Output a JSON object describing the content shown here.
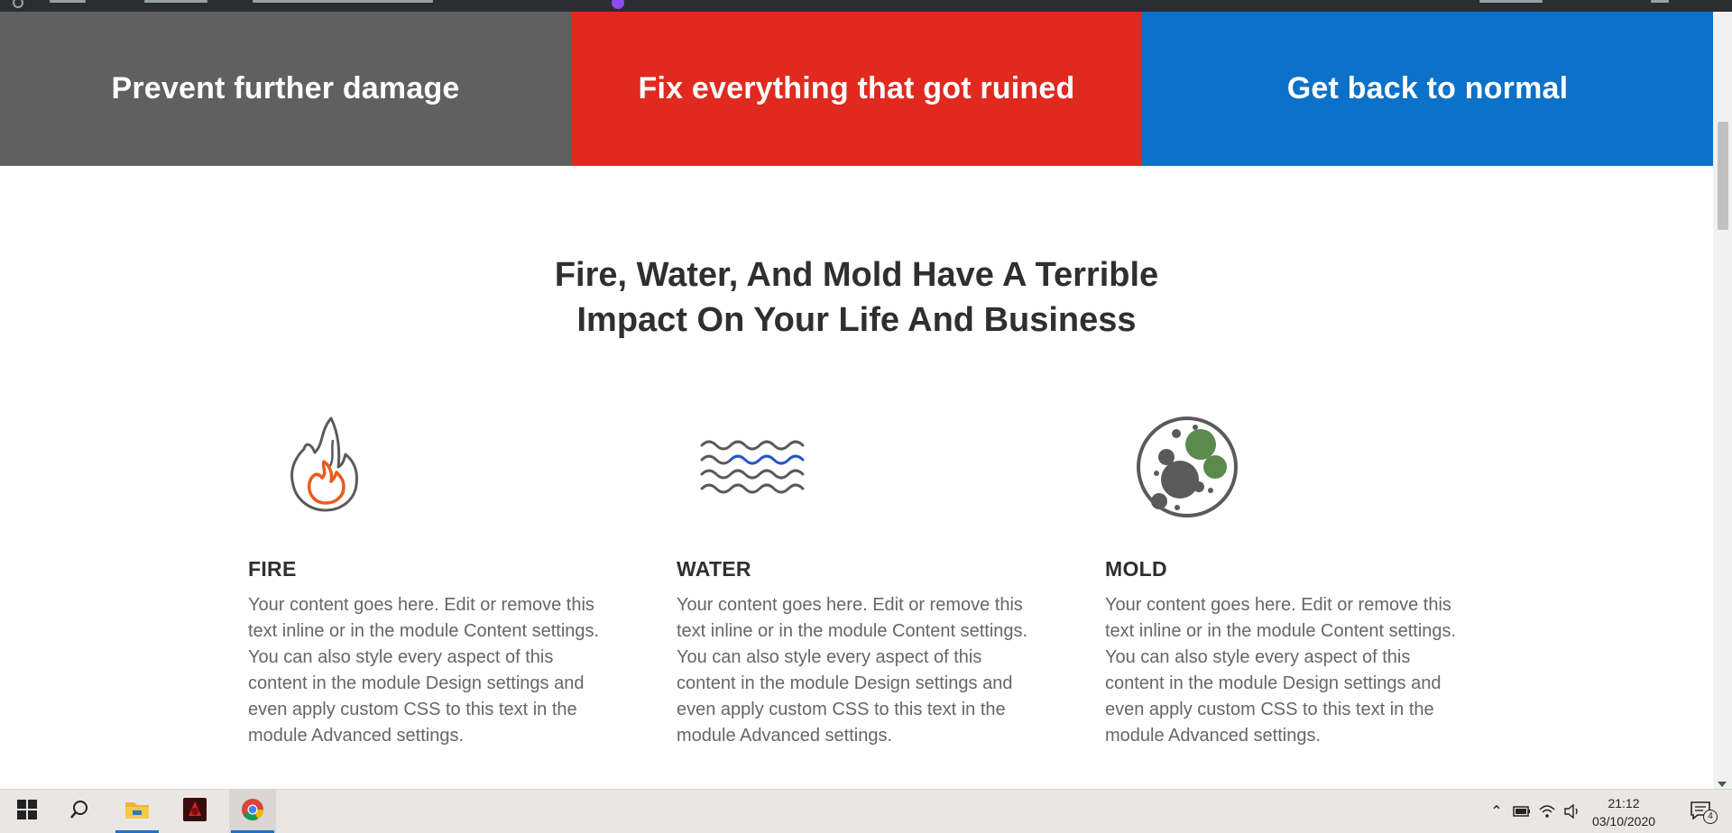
{
  "banner": {
    "items": [
      {
        "label": "Prevent further damage",
        "color": "#606060"
      },
      {
        "label": "Fix everything that got ruined",
        "color": "#e0291f"
      },
      {
        "label": "Get back to normal",
        "color": "#0c71c8"
      }
    ]
  },
  "section": {
    "heading_line1": "Fire, Water, And Mold Have A Terrible",
    "heading_line2": "Impact On Your Life And Business"
  },
  "features": [
    {
      "icon": "fire-icon",
      "title": "FIRE",
      "body": "Your content goes here. Edit or remove this text inline or in the module Content settings. You can also style every aspect of this content in the module Design settings and even apply custom CSS to this text in the module Advanced settings."
    },
    {
      "icon": "water-icon",
      "title": "WATER",
      "body": "Your content goes here. Edit or remove this text inline or in the module Content settings. You can also style every aspect of this content in the module Design settings and even apply custom CSS to this text in the module Advanced settings."
    },
    {
      "icon": "mold-icon",
      "title": "MOLD",
      "body": "Your content goes here. Edit or remove this text inline or in the module Content settings. You can also style every aspect of this content in the module Design settings and even apply custom CSS to this text in the module Advanced settings."
    }
  ],
  "taskbar": {
    "time": "21:12",
    "date": "03/10/2020",
    "notification_count": "4",
    "apps": [
      "start-icon",
      "search-icon",
      "file-explorer-icon",
      "app-icon",
      "chrome-icon"
    ]
  }
}
